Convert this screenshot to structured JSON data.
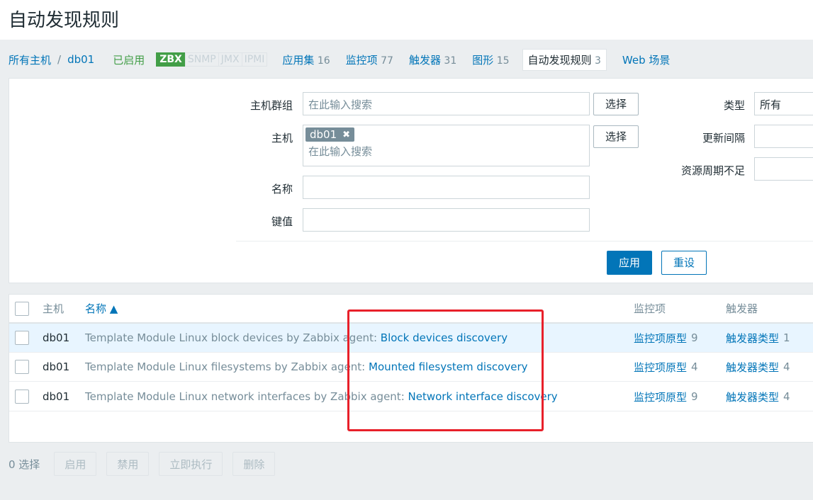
{
  "page": {
    "title": "自动发现规则"
  },
  "nav": {
    "all_hosts": "所有主机",
    "separator": "/",
    "host": "db01",
    "enabled": "已启用",
    "availability": [
      "ZBX",
      "SNMP",
      "JMX",
      "IPMI"
    ],
    "tabs": [
      {
        "label": "应用集",
        "count": "16"
      },
      {
        "label": "监控项",
        "count": "77"
      },
      {
        "label": "触发器",
        "count": "31"
      },
      {
        "label": "图形",
        "count": "15"
      },
      {
        "label": "自动发现规则",
        "count": "3"
      },
      {
        "label": "Web 场景",
        "count": ""
      }
    ]
  },
  "filter": {
    "host_group_label": "主机群组",
    "host_label": "主机",
    "name_label": "名称",
    "key_label": "键值",
    "search_placeholder": "在此输入搜索",
    "select_label": "选择",
    "host_tag": "db01",
    "type_label": "类型",
    "type_value": "所有",
    "interval_label": "更新间隔",
    "lifetime_label": "资源周期不足",
    "apply_label": "应用",
    "reset_label": "重设"
  },
  "table": {
    "headers": {
      "host": "主机",
      "name": "名称 ▲",
      "items": "监控项",
      "triggers": "触发器"
    },
    "rows": [
      {
        "host": "db01",
        "template": "Template Module Linux block devices by Zabbix agent:",
        "name": "Block devices discovery",
        "items_label": "监控项原型",
        "items_count": "9",
        "triggers_label": "触发器类型",
        "triggers_count": "1"
      },
      {
        "host": "db01",
        "template": "Template Module Linux filesystems by Zabbix agent:",
        "name": "Mounted filesystem discovery",
        "items_label": "监控项原型",
        "items_count": "4",
        "triggers_label": "触发器类型",
        "triggers_count": "4"
      },
      {
        "host": "db01",
        "template": "Template Module Linux network interfaces by Zabbix agent:",
        "name": "Network interface discovery",
        "items_label": "监控项原型",
        "items_count": "9",
        "triggers_label": "触发器类型",
        "triggers_count": "4"
      }
    ]
  },
  "bottom": {
    "selected": "0 选择",
    "buttons": [
      "启用",
      "禁用",
      "立即执行",
      "删除"
    ]
  },
  "colors": {
    "accent": "#0275b8",
    "enabled": "#429e47",
    "annotation": "#e8202a"
  }
}
